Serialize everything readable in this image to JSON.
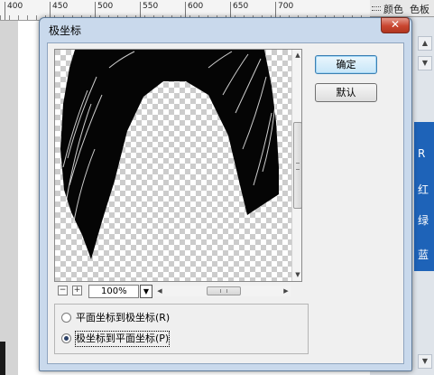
{
  "background": {
    "ruler_ticks": [
      "400",
      "450",
      "500",
      "550",
      "600",
      "650",
      "700"
    ],
    "panel_tabs": [
      "颜色",
      "色板"
    ],
    "panel_letters": [
      "R",
      "红",
      "绿",
      "蓝"
    ]
  },
  "dialog": {
    "title": "极坐标",
    "close_label": "✕",
    "ok_label": "确定",
    "default_label": "默认",
    "zoom": {
      "minus_label": "−",
      "plus_label": "+",
      "value": "100%"
    },
    "options": [
      {
        "label": "平面坐标到极坐标(R)",
        "selected": false
      },
      {
        "label": "极坐标到平面坐标(P)",
        "selected": true
      }
    ]
  }
}
